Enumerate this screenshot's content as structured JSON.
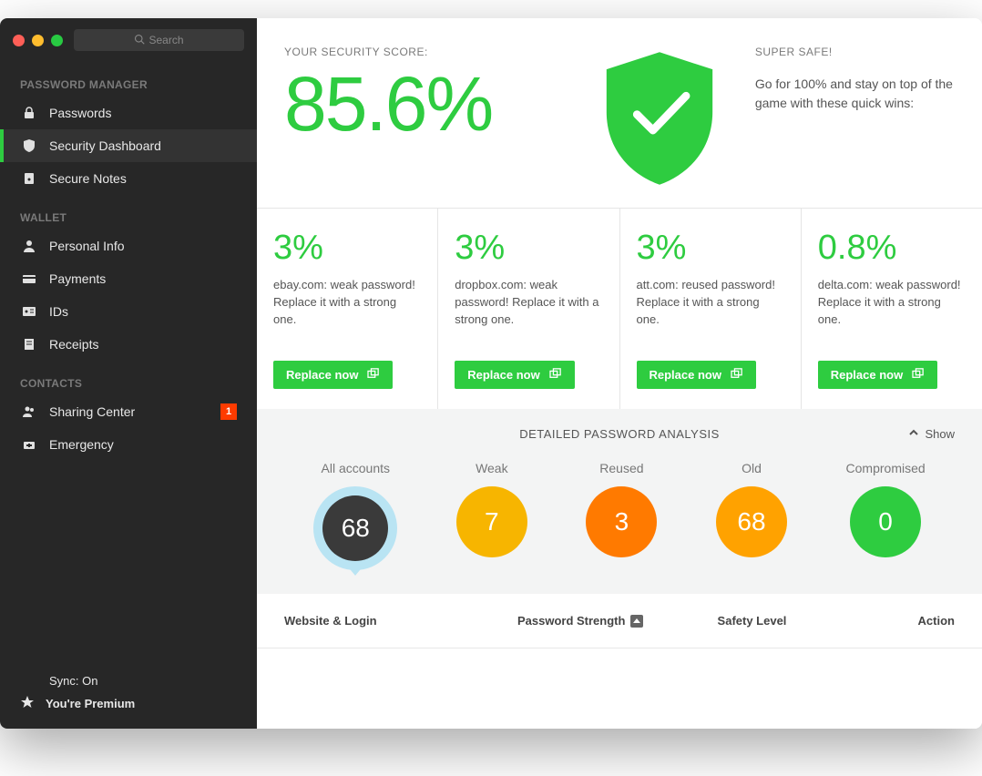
{
  "search": {
    "placeholder": "Search"
  },
  "sidebar": {
    "sections": [
      {
        "title": "PASSWORD MANAGER",
        "items": [
          {
            "label": "Passwords"
          },
          {
            "label": "Security Dashboard",
            "active": true
          },
          {
            "label": "Secure Notes"
          }
        ]
      },
      {
        "title": "WALLET",
        "items": [
          {
            "label": "Personal Info"
          },
          {
            "label": "Payments"
          },
          {
            "label": "IDs"
          },
          {
            "label": "Receipts"
          }
        ]
      },
      {
        "title": "CONTACTS",
        "items": [
          {
            "label": "Sharing Center",
            "badge": "1"
          },
          {
            "label": "Emergency"
          }
        ]
      }
    ],
    "footer": {
      "sync": "Sync: On",
      "premium": "You're Premium"
    }
  },
  "score": {
    "label": "YOUR SECURITY SCORE:",
    "value": "85.6%",
    "safe_label": "SUPER SAFE!",
    "safe_text": "Go for 100% and stay on top of the game with these quick wins:"
  },
  "tips": [
    {
      "pct": "3%",
      "text": "ebay.com: weak password! Replace it with a strong one.",
      "btn": "Replace now"
    },
    {
      "pct": "3%",
      "text": "dropbox.com: weak password! Replace it with a strong one.",
      "btn": "Replace now"
    },
    {
      "pct": "3%",
      "text": "att.com: reused password! Replace it with a strong one.",
      "btn": "Replace now"
    },
    {
      "pct": "0.8%",
      "text": "delta.com: weak password! Replace it with a strong one.",
      "btn": "Replace now"
    }
  ],
  "analysis": {
    "title": "DETAILED PASSWORD ANALYSIS",
    "show": "Show",
    "bubbles": [
      {
        "label": "All accounts",
        "value": "68",
        "color": "#3a3a3a",
        "all": true
      },
      {
        "label": "Weak",
        "value": "7",
        "color": "#f7b500"
      },
      {
        "label": "Reused",
        "value": "3",
        "color": "#ff7a00"
      },
      {
        "label": "Old",
        "value": "68",
        "color": "#ffa200"
      },
      {
        "label": "Compromised",
        "value": "0",
        "color": "#2ecc40"
      }
    ]
  },
  "table": {
    "cols": [
      "Website & Login",
      "Password Strength",
      "Safety Level",
      "Action"
    ]
  }
}
